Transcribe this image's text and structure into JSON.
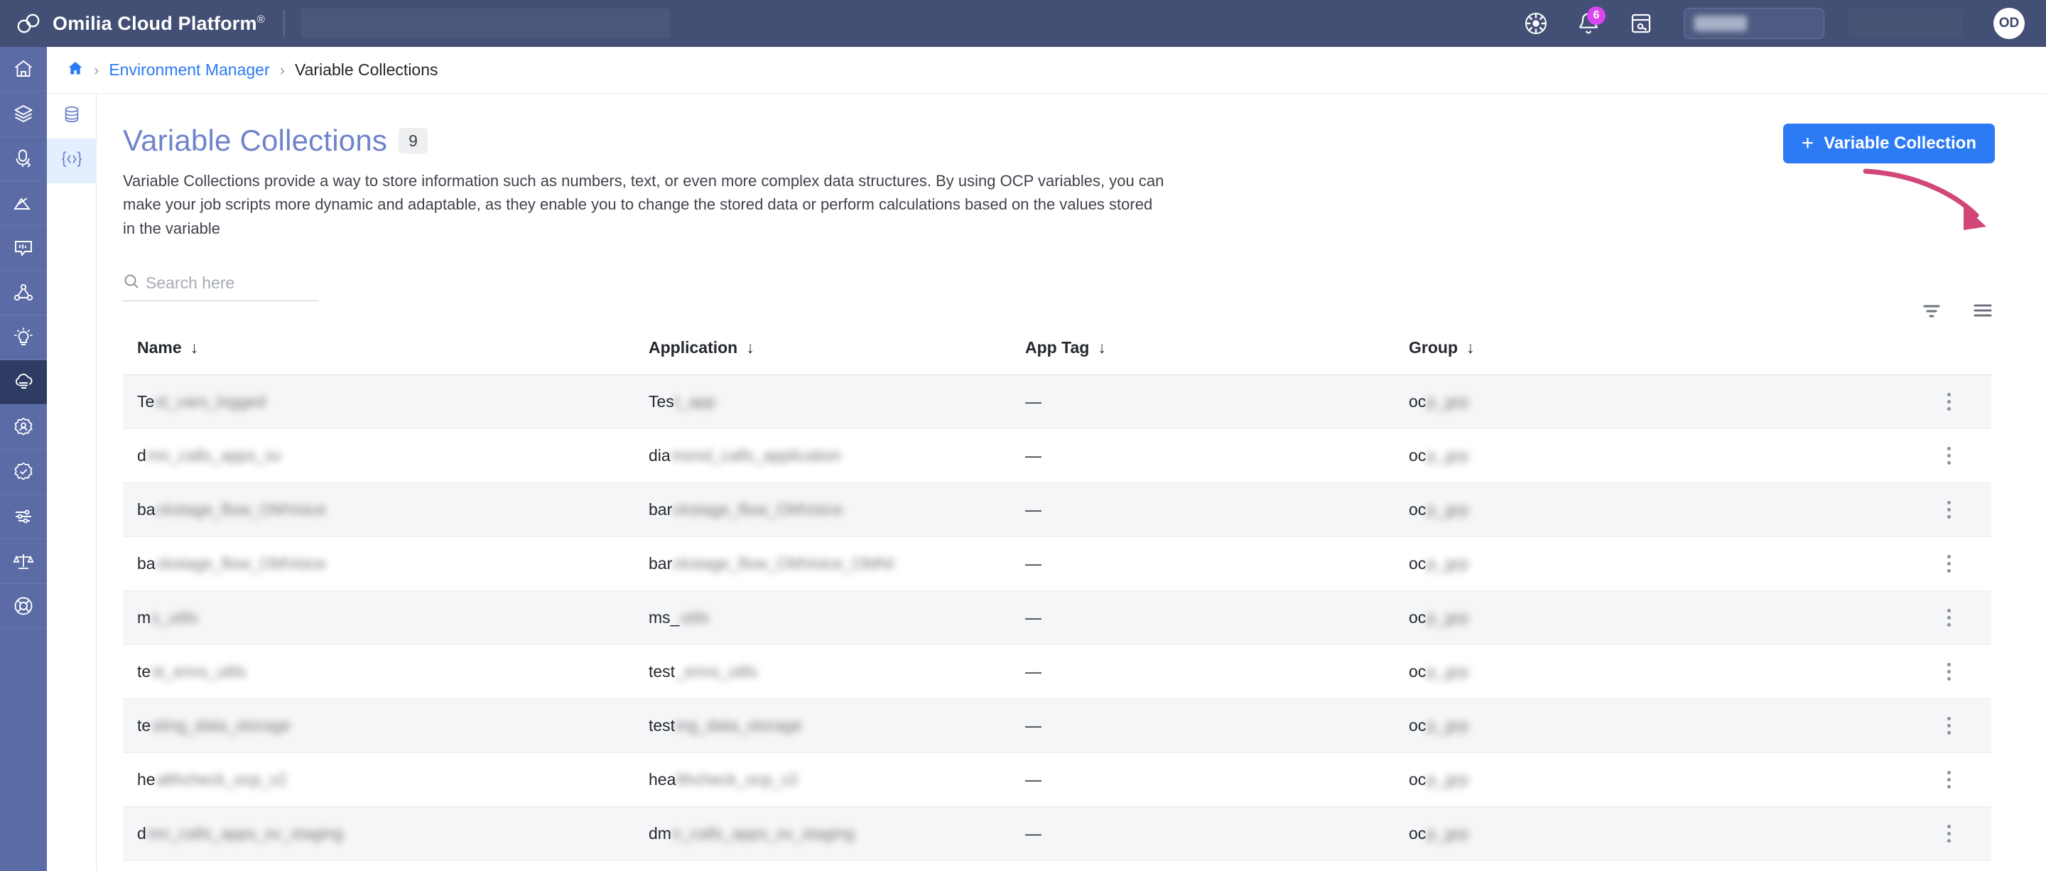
{
  "topbar": {
    "brand": "Omilia Cloud Platform",
    "brand_sup": "®",
    "notification_count": "6",
    "avatar_initials": "OD",
    "icons": [
      "settings-wheel-icon",
      "bell-icon",
      "note-key-icon"
    ]
  },
  "breadcrumb": {
    "home": "home-icon",
    "sep": "›",
    "parent": "Environment Manager",
    "current": "Variable Collections"
  },
  "sidebar": {
    "items": [
      {
        "name": "home",
        "active": false
      },
      {
        "name": "layers",
        "active": false
      },
      {
        "name": "voice-tag",
        "active": false
      },
      {
        "name": "analytics",
        "active": false
      },
      {
        "name": "dialog",
        "active": false
      },
      {
        "name": "graph",
        "active": false
      },
      {
        "name": "insight",
        "active": false
      },
      {
        "name": "cloud",
        "active": true
      },
      {
        "name": "user-settings",
        "active": false
      },
      {
        "name": "shield-check",
        "active": false
      },
      {
        "name": "sliders",
        "active": false
      },
      {
        "name": "scales",
        "active": false
      },
      {
        "name": "support",
        "active": false
      }
    ]
  },
  "subsidebar": {
    "items": [
      {
        "name": "database",
        "active": false
      },
      {
        "name": "code-brackets",
        "active": true
      }
    ]
  },
  "main": {
    "title": "Variable Collections",
    "count": "9",
    "description": "Variable Collections provide a way to store information such as numbers, text, or even more complex data structures. By using OCP variables, you can make your job scripts more dynamic and adaptable, as they enable you to change the stored data or perform calculations based on the values stored in the variable",
    "create_button": "Variable Collection",
    "create_button_plus": "+",
    "search_placeholder": "Search here",
    "search_value": "",
    "view_tools": [
      "filter-icon",
      "list-view-icon"
    ],
    "annotation": {
      "type": "curved-arrow",
      "color": "#d1477a",
      "points_to": "list-view-icon"
    }
  },
  "table": {
    "columns": [
      {
        "label": "Name",
        "sort": "↓"
      },
      {
        "label": "Application",
        "sort": "↓"
      },
      {
        "label": "App Tag",
        "sort": "↓"
      },
      {
        "label": "Group",
        "sort": "↓"
      }
    ],
    "rows": [
      {
        "name_clear": "Te",
        "name_redacted": "st_vars_logged",
        "app_clear": "Tes",
        "app_redacted": "t_app",
        "tag": "—",
        "group_clear": "oc",
        "group_redacted": "p_grp"
      },
      {
        "name_clear": "d",
        "name_redacted": "mn_calls_apps_sv",
        "app_clear": "dia",
        "app_redacted": "mond_calls_application",
        "tag": "—",
        "group_clear": "oc",
        "group_redacted": "p_grp"
      },
      {
        "name_clear": "ba",
        "name_redacted": "ckstage_flow_OMVoice",
        "app_clear": "bar",
        "app_redacted": "ckstage_flow_OMVoice",
        "tag": "—",
        "group_clear": "oc",
        "group_redacted": "p_grp"
      },
      {
        "name_clear": "ba",
        "name_redacted": "ckstage_flow_OMVoice",
        "app_clear": "bar",
        "app_redacted": "ckstage_flow_OMVoice_OMNI",
        "tag": "—",
        "group_clear": "oc",
        "group_redacted": "p_grp"
      },
      {
        "name_clear": "m",
        "name_redacted": "s_utils",
        "app_clear": "ms_",
        "app_redacted": "utils",
        "tag": "—",
        "group_clear": "oc",
        "group_redacted": "p_grp"
      },
      {
        "name_clear": "te",
        "name_redacted": "st_envs_utils",
        "app_clear": "test",
        "app_redacted": "_envs_utils",
        "tag": "—",
        "group_clear": "oc",
        "group_redacted": "p_grp"
      },
      {
        "name_clear": "te",
        "name_redacted": "sting_data_storage",
        "app_clear": "test",
        "app_redacted": "ing_data_storage",
        "tag": "—",
        "group_clear": "oc",
        "group_redacted": "p_grp"
      },
      {
        "name_clear": "he",
        "name_redacted": "althcheck_ocp_v2",
        "app_clear": "hea",
        "app_redacted": "lthcheck_ocp_v2",
        "tag": "—",
        "group_clear": "oc",
        "group_redacted": "p_grp"
      },
      {
        "name_clear": "d",
        "name_redacted": "mn_calls_apps_sv_staging",
        "app_clear": "dm",
        "app_redacted": "n_calls_apps_sv_staging",
        "tag": "—",
        "group_clear": "oc",
        "group_redacted": "p_grp"
      }
    ],
    "row_menu": "row-actions-kebab"
  },
  "colors": {
    "topbar_bg": "#434f74",
    "rail_bg": "#5a6ba5",
    "rail_active": "#2e3b63",
    "accent_blue": "#2d7bf4",
    "title_blue": "#6f83cb",
    "annotation_pink": "#d1477a",
    "badge_magenta": "#d946ef"
  }
}
